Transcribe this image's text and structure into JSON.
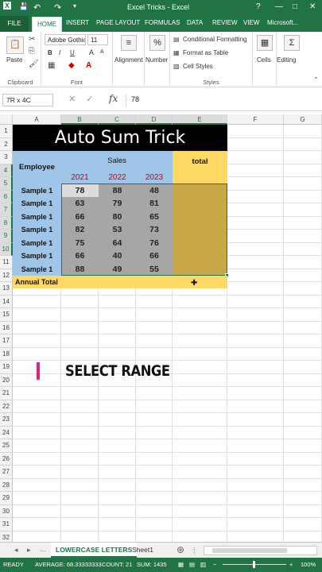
{
  "titlebar": {
    "app_icon": "X",
    "save_icon": "💾",
    "undo_icon": "↶",
    "redo_icon": "↷",
    "custom_icon": "▾",
    "title": "Excel Tricks - Excel",
    "help": "?",
    "minimize": "—",
    "maximize": "□",
    "close": "✕"
  },
  "tabs": {
    "file": "FILE",
    "home": "HOME",
    "insert": "INSERT",
    "page_layout": "PAGE LAYOUT",
    "formulas": "FORMULAS",
    "data": "DATA",
    "review": "REVIEW",
    "view": "VIEW",
    "account": "Microsoft..."
  },
  "ribbon": {
    "paste": "Paste",
    "clipboard": "Clipboard",
    "font_name": "Adobe Gothic",
    "font_size": "11",
    "bold": "B",
    "italic": "I",
    "underline": "U",
    "grow": "A",
    "shrink": "A",
    "font": "Font",
    "alignment": "Alignment",
    "number": "Number",
    "percent": "%",
    "conditional": "Conditional Formatting",
    "format_table": "Format as Table",
    "cell_styles": "Cell Styles",
    "styles": "Styles",
    "cells": "Cells",
    "editing": "Editing"
  },
  "formula_bar": {
    "name_box": "7R x 4C",
    "cancel": "✕",
    "enter": "✓",
    "fx": "fx",
    "value": "78"
  },
  "columns": [
    "A",
    "B",
    "C",
    "D",
    "E",
    "F",
    "G"
  ],
  "rows": [
    "1",
    "2",
    "3",
    "4",
    "5",
    "6",
    "7",
    "8",
    "9",
    "10",
    "11",
    "12",
    "13",
    "14",
    "15",
    "16",
    "17",
    "18",
    "19",
    "20",
    "21",
    "22",
    "23",
    "24",
    "25",
    "26",
    "27",
    "28",
    "29",
    "30",
    "31",
    "32"
  ],
  "sheet": {
    "title": "Auto Sum Trick",
    "employee": "Employee",
    "sales": "Sales",
    "total": "total",
    "years": [
      "2021",
      "2022",
      "2023"
    ],
    "annual_total": "Annual Total",
    "data_rows": [
      {
        "name": "Sample 1",
        "values": [
          "78",
          "88",
          "48"
        ]
      },
      {
        "name": "Sample 1",
        "values": [
          "63",
          "79",
          "81"
        ]
      },
      {
        "name": "Sample 1",
        "values": [
          "66",
          "80",
          "65"
        ]
      },
      {
        "name": "Sample 1",
        "values": [
          "82",
          "53",
          "73"
        ]
      },
      {
        "name": "Sample 1",
        "values": [
          "75",
          "64",
          "76"
        ]
      },
      {
        "name": "Sample 1",
        "values": [
          "66",
          "40",
          "66"
        ]
      },
      {
        "name": "Sample 1",
        "values": [
          "88",
          "49",
          "55"
        ]
      }
    ]
  },
  "overlay": {
    "caption": "SELECT RANGE"
  },
  "sheet_tabs": {
    "prev": "◂",
    "next": "▸",
    "more": "...",
    "active": "LOWERCASE LETTERS",
    "other": "Sheet1",
    "add": "⊕"
  },
  "status": {
    "ready": "READY",
    "average": "AVERAGE: 68.33333333",
    "count": "COUNT: 21",
    "sum": "SUM: 1435",
    "zoom": "100%"
  },
  "colors": {
    "excel_green": "#217346",
    "header_blue": "#9fc5e8",
    "total_yellow": "#ffd966",
    "selection_gray": "#a6a6a6",
    "selection_gold": "#c9a84a",
    "year_red": "#c0001a",
    "title_black": "#000000",
    "accent_pink": "#e0218a"
  }
}
